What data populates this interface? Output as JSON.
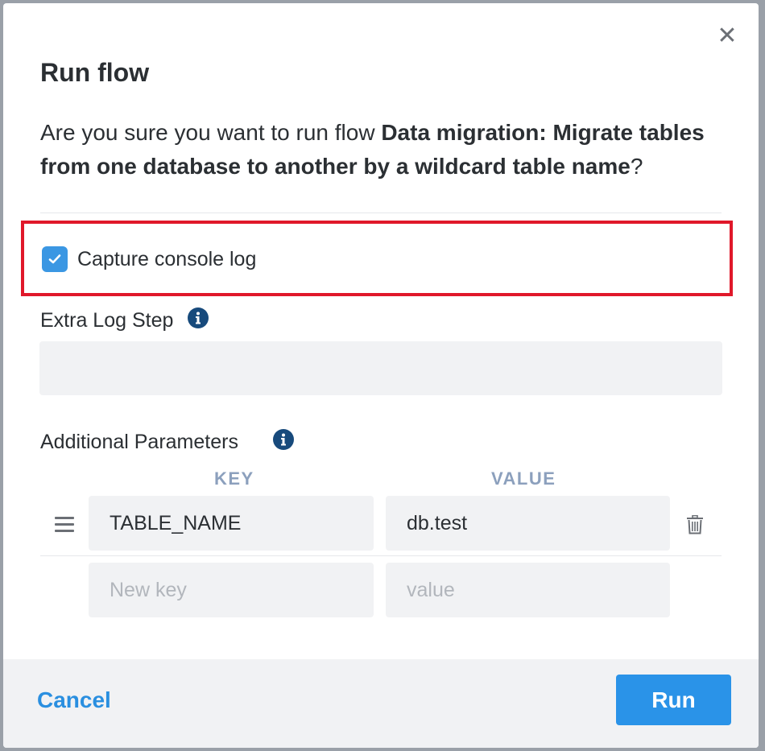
{
  "dialog": {
    "title": "Run flow",
    "question_prefix": "Are you sure you want to run flow ",
    "flow_name": "Data migration: Migrate tables from one database to another by a wildcard table name",
    "question_suffix": "?",
    "close_icon": "close-icon"
  },
  "capture_console_log": {
    "label": "Capture console log",
    "checked": true
  },
  "extra_log_step": {
    "label": "Extra Log Step",
    "value": ""
  },
  "additional_parameters": {
    "label": "Additional Parameters",
    "key_header": "KEY",
    "value_header": "VALUE",
    "rows": [
      {
        "key": "TABLE_NAME",
        "value": "db.test"
      }
    ],
    "new_row": {
      "key_placeholder": "New key",
      "value_placeholder": "value"
    }
  },
  "footer": {
    "cancel_label": "Cancel",
    "run_label": "Run"
  },
  "colors": {
    "accent": "#2a93e8",
    "highlight": "#e0182a",
    "info_icon": "#174a7c",
    "column_header": "#8ca0bd"
  }
}
